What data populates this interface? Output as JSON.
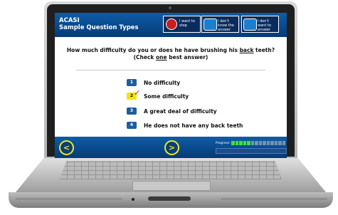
{
  "app": {
    "title_line1": "ACASI",
    "title_line2": "Sample Question Types"
  },
  "header_buttons": [
    {
      "label": "I want to stop",
      "icon": "stop-icon"
    },
    {
      "label": "I don't know the answer",
      "icon": "dont-know-icon"
    },
    {
      "label": "I don't want to answer",
      "icon": "dont-want-icon"
    }
  ],
  "question": {
    "line1_prefix": "How much difficulty do you or does he have brushing his ",
    "line1_underlined": "back",
    "line1_suffix": " teeth?",
    "line2_prefix": "(Check ",
    "line2_underlined": "one",
    "line2_suffix": " best answer)"
  },
  "answers": [
    {
      "number": "1",
      "label": "No difficulty",
      "selected": false
    },
    {
      "number": "2",
      "label": "Some difficulty",
      "selected": true
    },
    {
      "number": "3",
      "label": "A great deal of difficulty",
      "selected": false
    },
    {
      "number": "4",
      "label": "He does not have any back teeth",
      "selected": false
    }
  ],
  "footer": {
    "back_symbol": "<",
    "next_symbol": ">",
    "progress_label": "Progress:",
    "progress_segments_total": 14,
    "progress_segments_done": 5
  },
  "colors": {
    "header_blue": "#0d5da8",
    "selected_yellow": "#f2e600",
    "check_red": "#d61d1d",
    "progress_green": "#44e030"
  }
}
